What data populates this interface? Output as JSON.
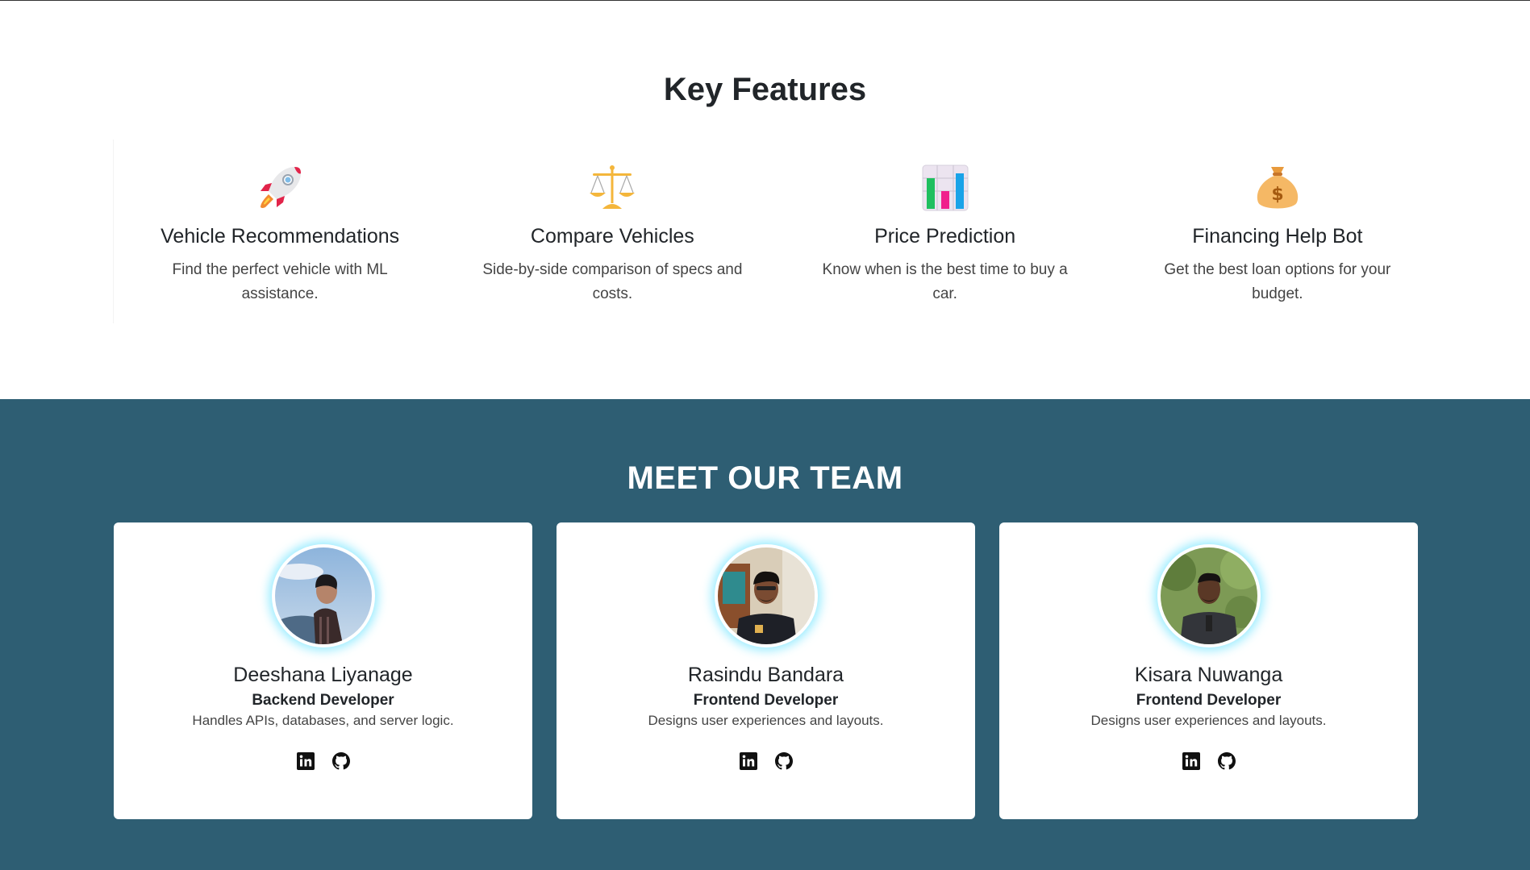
{
  "features": {
    "title": "Key Features",
    "items": [
      {
        "icon": "rocket-icon",
        "title": "Vehicle Recommendations",
        "desc": "Find the perfect vehicle with ML assistance."
      },
      {
        "icon": "balance-scale-icon",
        "title": "Compare Vehicles",
        "desc": "Side-by-side comparison of specs and costs."
      },
      {
        "icon": "bar-chart-icon",
        "title": "Price Prediction",
        "desc": "Know when is the best time to buy a car."
      },
      {
        "icon": "money-bag-icon",
        "title": "Financing Help Bot",
        "desc": "Get the best loan options for your budget."
      }
    ]
  },
  "team": {
    "title": "MEET OUR TEAM",
    "background": "#2e5e73",
    "members": [
      {
        "name": "Deeshana Liyanage",
        "role": "Backend Developer",
        "desc": "Handles APIs, databases, and server logic."
      },
      {
        "name": "Rasindu Bandara",
        "role": "Frontend Developer",
        "desc": "Designs user experiences and layouts."
      },
      {
        "name": "Kisara Nuwanga",
        "role": "Frontend Developer",
        "desc": "Designs user experiences and layouts."
      }
    ]
  }
}
